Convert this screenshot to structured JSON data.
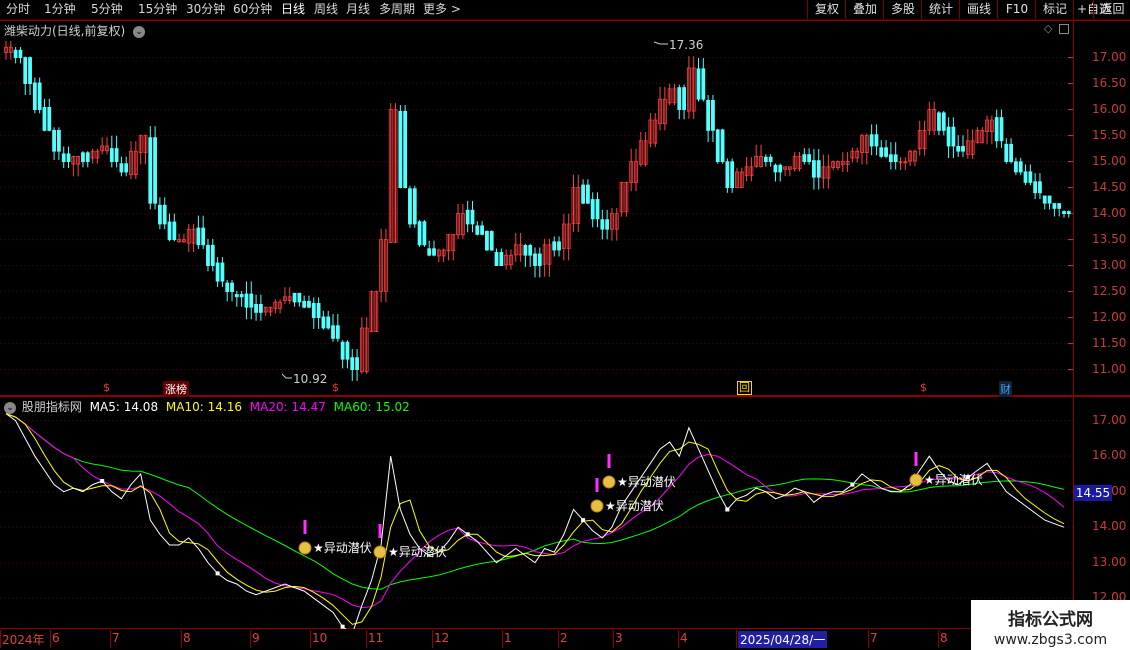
{
  "toolbar": {
    "periods": [
      "分时",
      "1分钟",
      "5分钟",
      "15分钟",
      "30分钟",
      "60分钟",
      "日线",
      "周线",
      "月线",
      "多周期",
      "更多 >"
    ],
    "active_period": "日线",
    "buttons": [
      "复权",
      "叠加",
      "多股",
      "统计",
      "画线",
      "F10",
      "标记",
      "+自选",
      "返回"
    ]
  },
  "main_chart": {
    "title": "潍柴动力(日线,前复权)",
    "high_label": "17.36",
    "low_label": "10.92",
    "y_ticks": [
      "17.00",
      "16.50",
      "16.00",
      "15.50",
      "15.00",
      "14.50",
      "14.00",
      "13.50",
      "13.00",
      "12.50",
      "12.00",
      "11.50",
      "11.00"
    ],
    "markers": [
      {
        "text": "$",
        "color": "#ff3030"
      },
      {
        "text": "涨榜",
        "color": "#ffffff"
      },
      {
        "text": "$",
        "color": "#ff3030"
      },
      {
        "text": "回",
        "color": "#ffd800"
      },
      {
        "text": "$",
        "color": "#ff3030"
      },
      {
        "text": "财",
        "color": "#40a0ff"
      }
    ]
  },
  "indicator": {
    "name": "股朋指标网",
    "ma5": "MA5: 14.08",
    "ma10": "MA10: 14.16",
    "ma20": "MA20: 14.47",
    "ma60": "MA60: 15.02",
    "colors": {
      "ma5": "#ffffff",
      "ma10": "#ffff00",
      "ma20": "#ff00ff",
      "ma60": "#00ff00"
    },
    "y_ticks": [
      "17.00",
      "16.00",
      "15.00",
      "14.00",
      "13.00",
      "12.00"
    ],
    "current_value": "14.55",
    "signal_label": "异动潜伏"
  },
  "x_axis": {
    "labels": [
      "2024年",
      "6",
      "7",
      "8",
      "9",
      "10",
      "11",
      "12",
      "1",
      "2",
      "3",
      "4",
      "2025/04/28/一",
      "7",
      "8"
    ]
  },
  "watermark": {
    "title": "指标公式网",
    "url": "www.zbgs3.com"
  },
  "chart_data": {
    "type": "candlestick",
    "title": "潍柴动力(日线,前复权)",
    "y_range": [
      10.8,
      17.3
    ],
    "close_series_approx": [
      17.2,
      17.0,
      16.5,
      16.0,
      15.6,
      15.2,
      15.0,
      15.1,
      15.0,
      15.2,
      15.3,
      15.0,
      14.8,
      15.2,
      15.5,
      14.2,
      13.8,
      13.5,
      13.5,
      13.7,
      13.4,
      13.0,
      12.7,
      12.5,
      12.4,
      12.2,
      12.1,
      12.2,
      12.3,
      12.4,
      12.3,
      12.2,
      12.0,
      11.8,
      11.6,
      11.2,
      11.0,
      11.8,
      12.5,
      13.5,
      16.0,
      14.5,
      13.8,
      13.4,
      13.2,
      13.3,
      13.6,
      14.0,
      13.8,
      13.6,
      13.3,
      13.0,
      13.2,
      13.4,
      13.2,
      13.0,
      13.4,
      13.3,
      13.8,
      14.5,
      14.2,
      13.9,
      13.7,
      14.0,
      14.6,
      15.0,
      15.4,
      15.8,
      16.2,
      16.4,
      16.0,
      16.8,
      16.2,
      15.6,
      15.0,
      14.5,
      14.8,
      14.9,
      15.1,
      15.0,
      14.8,
      14.9,
      15.1,
      15.0,
      14.7,
      14.9,
      15.0,
      15.0,
      15.2,
      15.5,
      15.3,
      15.1,
      15.0,
      15.0,
      15.2,
      15.6,
      16.0,
      15.6,
      15.3,
      15.2,
      15.4,
      15.6,
      15.8,
      15.4,
      15.0,
      14.8,
      14.6,
      14.4,
      14.2,
      14.1,
      14.0
    ],
    "annotations": {
      "max": "17.36",
      "min": "10.92"
    }
  }
}
